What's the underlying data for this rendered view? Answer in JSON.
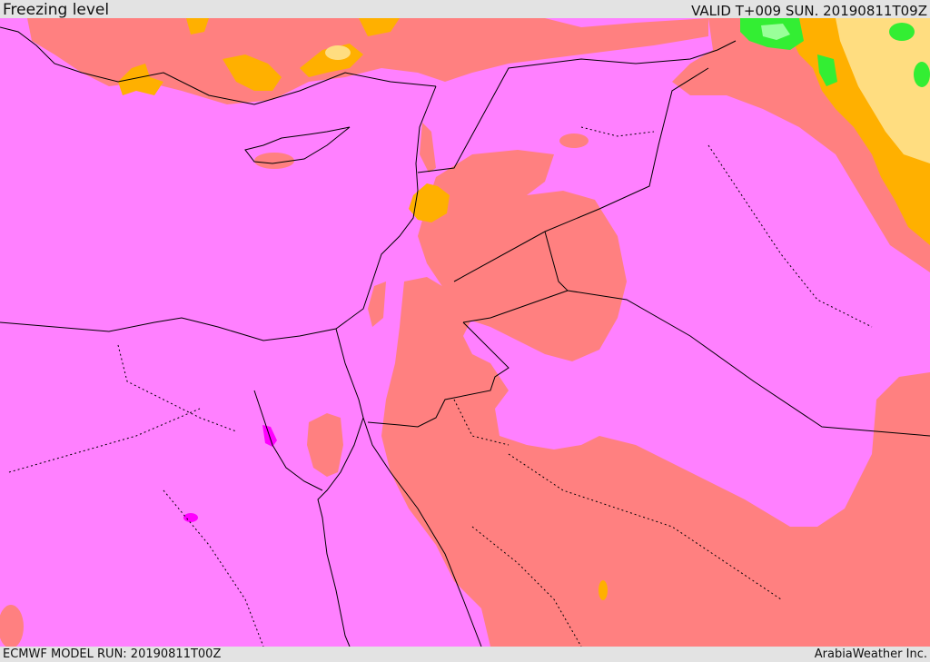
{
  "header": {
    "title": "Freezing level",
    "valid_time": "VALID T+009 SUN. 20190811T09Z"
  },
  "footer": {
    "model_run": "ECMWF MODEL RUN: 20190811T00Z",
    "credit": "ArabiaWeather Inc."
  },
  "map": {
    "parameter": "freezing level",
    "colors": {
      "background": "#ff80ff",
      "salmon": "#ff8080",
      "orange": "#ffb000",
      "light_orange": "#ffdd80",
      "green": "#33ee33",
      "light_green": "#99ff99",
      "magenta": "#ff00ff",
      "boundary": "#000000"
    }
  }
}
